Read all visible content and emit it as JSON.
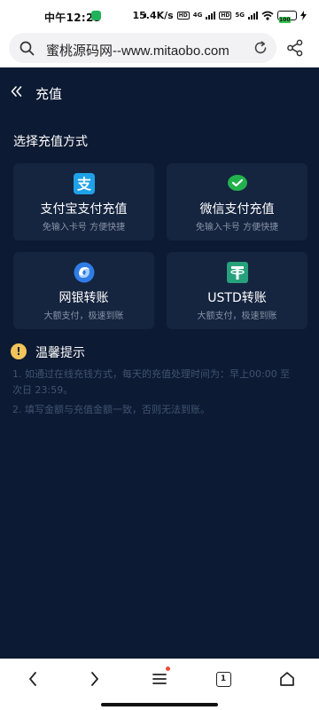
{
  "status_bar": {
    "time": "中午12:25",
    "net_speed": "15.4K/s",
    "hd1": "HD",
    "net1": "4G",
    "hd2": "HD",
    "net2": "5G",
    "battery": "100"
  },
  "browser": {
    "url": "蜜桃源码网--www.mitaobo.com",
    "tab_count": "1"
  },
  "page": {
    "title": "充值",
    "section_title": "选择充值方式",
    "methods": [
      {
        "label": "支付宝支付充值",
        "sub": "免输入卡号 方便快捷",
        "icon": "alipay-icon",
        "color": "#1ea1e8"
      },
      {
        "label": "微信支付充值",
        "sub": "免输入卡号 方便快捷",
        "icon": "wechat-pay-icon",
        "color": "#22b14c"
      },
      {
        "label": "网银转账",
        "sub": "大额支付，极速到账",
        "icon": "unionpay-icon",
        "color": "#2f7ce6"
      },
      {
        "label": "USTD转账",
        "sub": "大额支付，极速到账",
        "icon": "tether-icon",
        "color": "#26a17b"
      }
    ],
    "tips_title": "温馨提示",
    "tips": [
      "1. 如通过在线充钱方式，每天的充值处理时间为：早上00:00 至次日 23:59。",
      "2. 填写金额与充值金额一致，否则无法到账。"
    ]
  },
  "colors": {
    "background": "#0d1a33",
    "card": "#15243f",
    "tip_text": "#3f5370",
    "warning": "#f2c45a"
  }
}
